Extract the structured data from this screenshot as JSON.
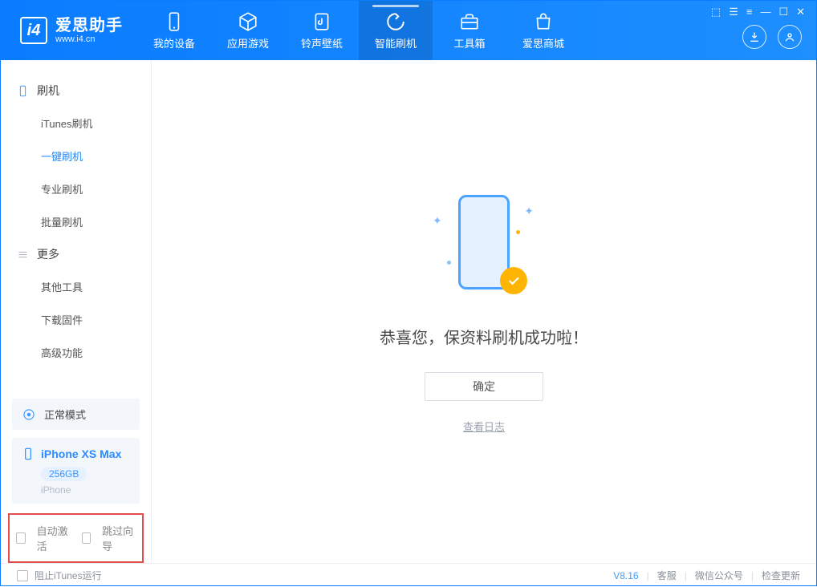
{
  "app": {
    "title": "爱思助手",
    "subtitle": "www.i4.cn"
  },
  "nav": {
    "tabs": [
      {
        "label": "我的设备"
      },
      {
        "label": "应用游戏"
      },
      {
        "label": "铃声壁纸"
      },
      {
        "label": "智能刷机"
      },
      {
        "label": "工具箱"
      },
      {
        "label": "爱思商城"
      }
    ]
  },
  "sidebar": {
    "section1": {
      "title": "刷机",
      "items": [
        "iTunes刷机",
        "一键刷机",
        "专业刷机",
        "批量刷机"
      ]
    },
    "section2": {
      "title": "更多",
      "items": [
        "其他工具",
        "下载固件",
        "高级功能"
      ]
    },
    "mode": "正常模式",
    "device": {
      "name": "iPhone XS Max",
      "storage": "256GB",
      "type": "iPhone"
    },
    "activation": {
      "auto": "自动激活",
      "skip": "跳过向导"
    }
  },
  "main": {
    "success_message": "恭喜您，保资料刷机成功啦！",
    "ok_button": "确定",
    "view_log": "查看日志"
  },
  "footer": {
    "block_itunes": "阻止iTunes运行",
    "version": "V8.16",
    "links": [
      "客服",
      "微信公众号",
      "检查更新"
    ]
  }
}
